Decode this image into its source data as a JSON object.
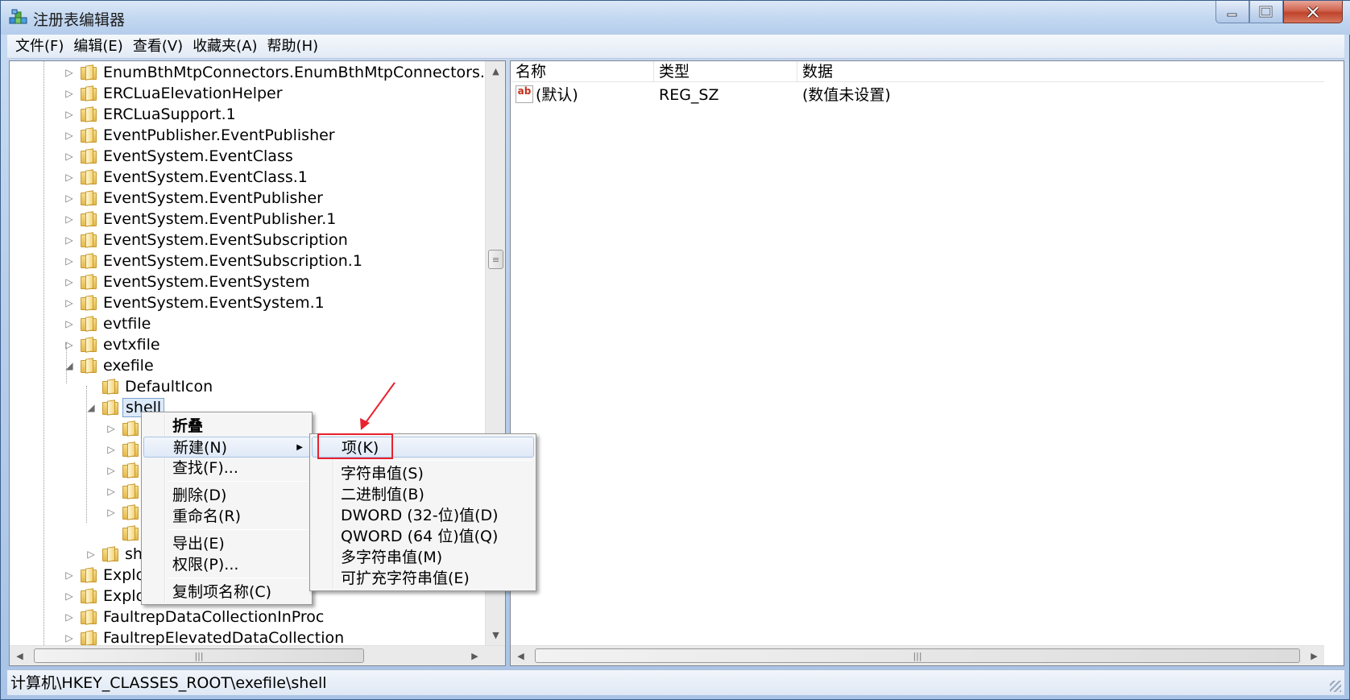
{
  "window": {
    "title": "注册表编辑器",
    "controls": {
      "minimize": "▁",
      "maximize": "▢",
      "close": "✕"
    }
  },
  "menubar": [
    "文件(F)",
    "编辑(E)",
    "查看(V)",
    "收藏夹(A)",
    "帮助(H)"
  ],
  "tree": {
    "items": [
      {
        "label": "EnumBthMtpConnectors.EnumBthMtpConnectors.1",
        "expander": "▷"
      },
      {
        "label": "ERCLuaElevationHelper",
        "expander": "▷"
      },
      {
        "label": "ERCLuaSupport.1",
        "expander": "▷"
      },
      {
        "label": "EventPublisher.EventPublisher",
        "expander": "▷"
      },
      {
        "label": "EventSystem.EventClass",
        "expander": "▷"
      },
      {
        "label": "EventSystem.EventClass.1",
        "expander": "▷"
      },
      {
        "label": "EventSystem.EventPublisher",
        "expander": "▷"
      },
      {
        "label": "EventSystem.EventPublisher.1",
        "expander": "▷"
      },
      {
        "label": "EventSystem.EventSubscription",
        "expander": "▷"
      },
      {
        "label": "EventSystem.EventSubscription.1",
        "expander": "▷"
      },
      {
        "label": "EventSystem.EventSystem",
        "expander": "▷"
      },
      {
        "label": "EventSystem.EventSystem.1",
        "expander": "▷"
      },
      {
        "label": "evtfile",
        "expander": "▷"
      },
      {
        "label": "evtxfile",
        "expander": "▷"
      },
      {
        "label": "exefile",
        "expander": "◢"
      },
      {
        "label": "DefaultIcon",
        "expander": ""
      },
      {
        "label": "shell",
        "expander": "◢"
      },
      {
        "label": "",
        "expander": "▷"
      },
      {
        "label": "",
        "expander": "▷"
      },
      {
        "label": "",
        "expander": "▷"
      },
      {
        "label": "",
        "expander": "▷"
      },
      {
        "label": "",
        "expander": "▷"
      },
      {
        "label": "",
        "expander": ""
      },
      {
        "label": "sh",
        "expander": "▷"
      },
      {
        "label": "Explo",
        "expander": "▷"
      },
      {
        "label": "Explo",
        "expander": "▷"
      },
      {
        "label": "FaultrepDataCollectionInProc",
        "expander": "▷"
      },
      {
        "label": "FaultrepElevatedDataCollection",
        "expander": "▷"
      }
    ]
  },
  "list": {
    "columns": [
      "名称",
      "类型",
      "数据"
    ],
    "rows": [
      {
        "icon": "ab",
        "name": "(默认)",
        "type": "REG_SZ",
        "data": "(数值未设置)"
      }
    ]
  },
  "context_menu": {
    "items": [
      "折叠",
      "新建(N)",
      "查找(F)...",
      "删除(D)",
      "重命名(R)",
      "导出(E)",
      "权限(P)...",
      "复制项名称(C)"
    ]
  },
  "submenu": {
    "items": [
      "项(K)",
      "字符串值(S)",
      "二进制值(B)",
      "DWORD (32-位)值(D)",
      "QWORD (64 位)值(Q)",
      "多字符串值(M)",
      "可扩充字符串值(E)"
    ]
  },
  "statusbar": {
    "path": "计算机\\HKEY_CLASSES_ROOT\\exefile\\shell"
  },
  "colors": {
    "annotation": "#e8222e",
    "selection": "#dce9f9",
    "titlebar": "#c3d8f1"
  },
  "scroll": {
    "vertical_arrow_up": "▲",
    "vertical_arrow_down": "▼",
    "left": "◀",
    "right": "▶",
    "grip": "≡",
    "hgrip": "|||"
  }
}
